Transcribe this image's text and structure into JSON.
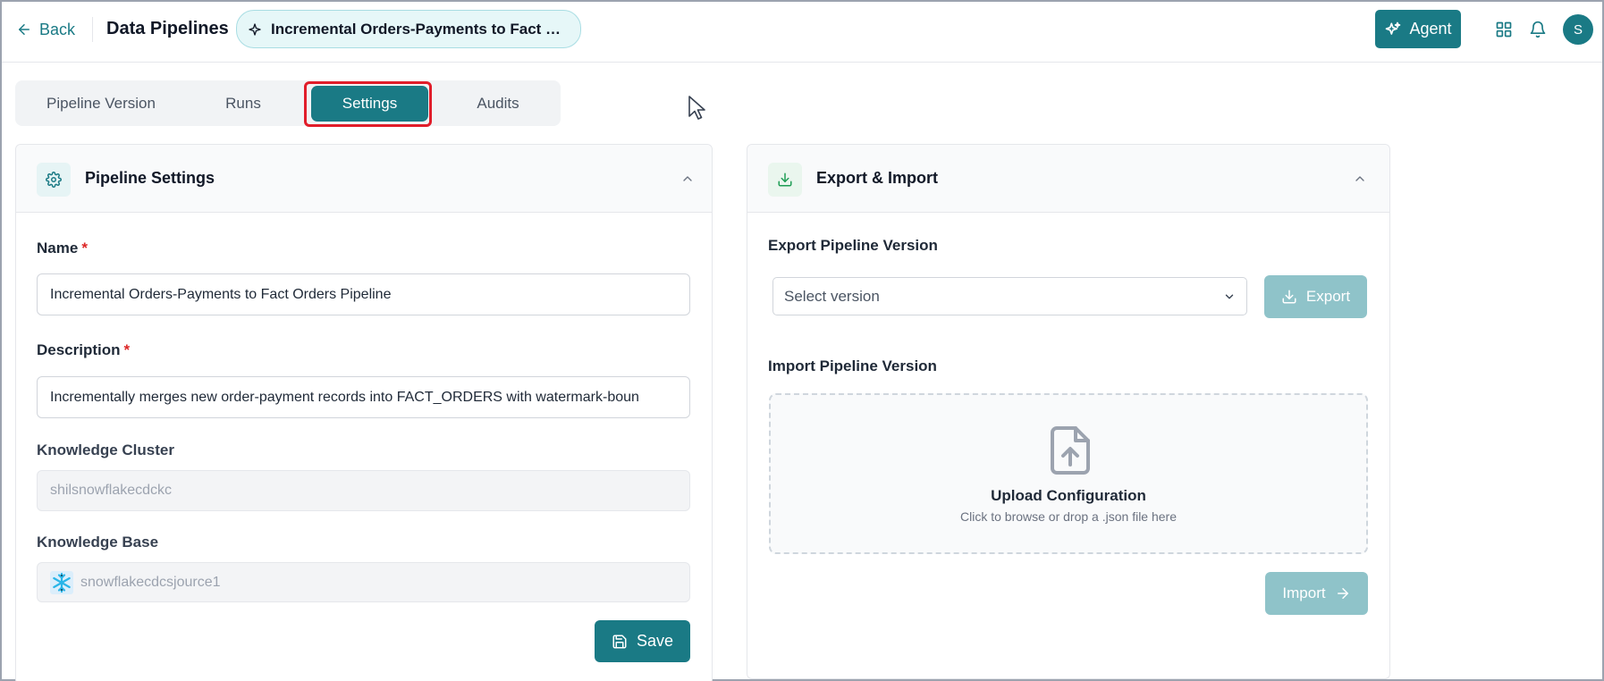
{
  "header": {
    "back_label": "Back",
    "app_title": "Data Pipelines",
    "pipeline_chip": "Incremental Orders-Payments to Fact Orders Pipeline",
    "agent_label": "Agent",
    "avatar_initial": "S",
    "icons": [
      "arrow-left-icon",
      "sparkle-icon",
      "grid-icon",
      "bell-icon"
    ]
  },
  "tabs": [
    {
      "label": "Pipeline Version",
      "active": false
    },
    {
      "label": "Runs",
      "active": false
    },
    {
      "label": "Settings",
      "active": true
    },
    {
      "label": "Audits",
      "active": false
    }
  ],
  "pipeline_settings": {
    "title": "Pipeline Settings",
    "name_label": "Name",
    "name_value": "Incremental Orders-Payments to Fact Orders Pipeline",
    "description_label": "Description",
    "description_value": "Incrementally merges new order-payment records into FACT_ORDERS with watermark-boun",
    "knowledge_cluster_label": "Knowledge Cluster",
    "knowledge_cluster_value": "shilsnowflakecdckc",
    "knowledge_base_label": "Knowledge Base",
    "knowledge_base_value": "snowflakecdcsjource1",
    "required_mark": "*",
    "save_label": "Save"
  },
  "export_import": {
    "title": "Export & Import",
    "export_section_label": "Export Pipeline Version",
    "select_placeholder": "Select version",
    "export_label": "Export",
    "import_section_label": "Import Pipeline Version",
    "upload_title": "Upload Configuration",
    "upload_hint": "Click to browse or drop a .json file here",
    "import_label": "Import"
  },
  "colors": {
    "accent": "#1a7a85",
    "accent_muted": "#8fc3c9",
    "highlight": "#e11d2a",
    "required": "#dc2626"
  }
}
